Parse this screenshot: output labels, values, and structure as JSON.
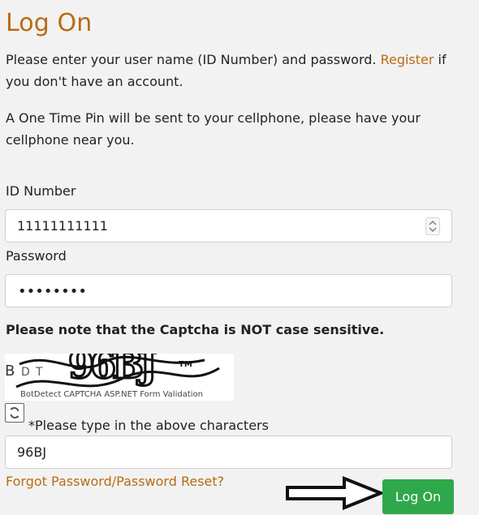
{
  "page_title": "Log On",
  "intro": {
    "before_link": "Please enter your user name (ID Number) and password. ",
    "link": "Register",
    "after_link": " if you don't have an account."
  },
  "otp_notice": "A One Time Pin will be sent to your cellphone, please have your cellphone near you.",
  "fields": {
    "id_label": "ID Number",
    "id_value": "11111111111",
    "password_label": "Password",
    "password_dots": "••••••••"
  },
  "captcha": {
    "note": "Please note that the Captcha is NOT case sensitive.",
    "caption": "BotDetect CAPTCHA ASP.NET Form Validation",
    "prompt": "*Please type in the above characters",
    "value": "96BJ",
    "image_text": "96BJ"
  },
  "links": {
    "forgot_password": "Forgot Password/Password Reset?"
  },
  "buttons": {
    "logon": "Log On"
  },
  "colors": {
    "background": "#f2f2f2",
    "accent": "#b96b12",
    "button": "#2fa84b",
    "text": "#222222"
  },
  "icons": {
    "refresh": "refresh-icon",
    "stepper": "number-stepper-icon",
    "arrow": "arrow-right-icon"
  }
}
